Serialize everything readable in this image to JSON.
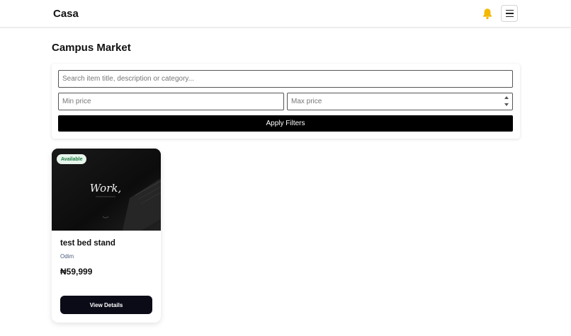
{
  "navbar": {
    "brand": "Casa",
    "bell_icon": "bell-icon",
    "menu_icon": "hamburger-menu-icon",
    "bell_color": "#f5b800"
  },
  "page": {
    "title": "Campus Market"
  },
  "filters": {
    "search_placeholder": "Search item title, description or category...",
    "search_value": "",
    "min_price_placeholder": "Min price",
    "min_price_value": "",
    "max_price_placeholder": "Max price",
    "max_price_value": "",
    "apply_label": "Apply Filters"
  },
  "listings": [
    {
      "badge": "Available",
      "badge_color": "#1d7a3e",
      "image_caption": "Work,",
      "title": "test bed stand",
      "seller": "Odim",
      "price": "₦59,999",
      "button_label": "View Details"
    }
  ]
}
